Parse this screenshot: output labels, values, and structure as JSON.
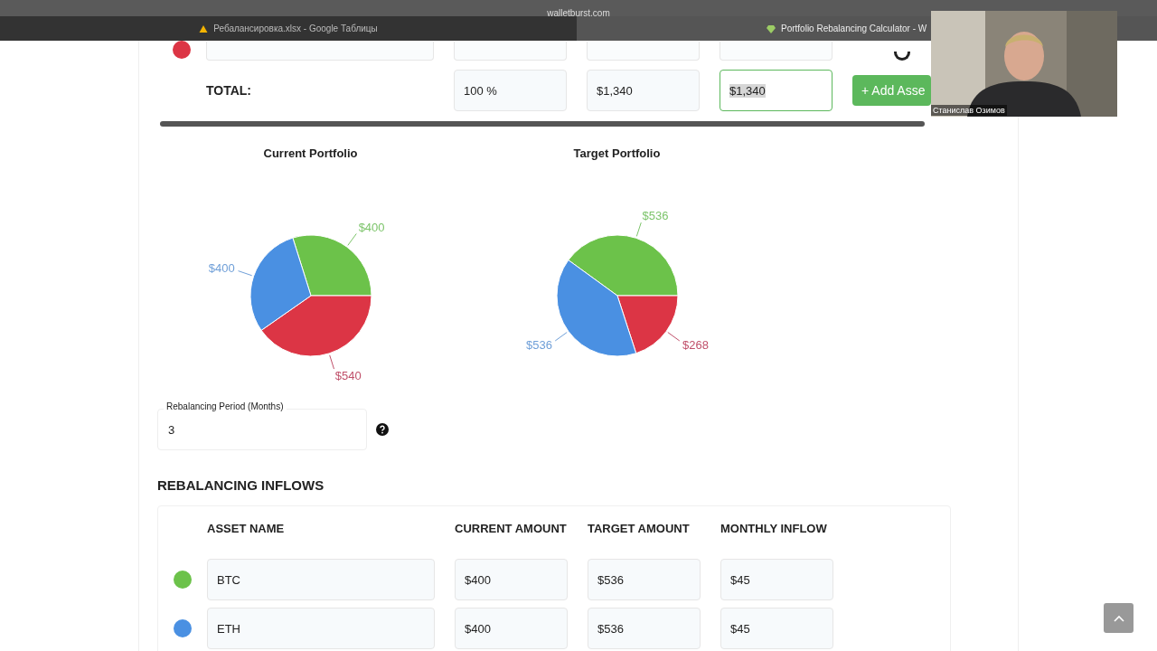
{
  "browser": {
    "address": "walletburst.com",
    "tabs": [
      {
        "title": "Ребалансировка.xlsx - Google Таблицы",
        "selected": false
      },
      {
        "title": "Portfolio Rebalancing Calculator - W",
        "selected": true
      }
    ]
  },
  "webcam": {
    "kind": "picture",
    "name": "Станислав Озимов"
  },
  "allocation": {
    "partial_row": {
      "color": "#dc3545"
    },
    "total": {
      "label": "TOTAL:",
      "percent": "100 %",
      "current": "$1,340",
      "target": "$1,340"
    },
    "add_button": "+ Add Asse"
  },
  "charts": [
    {
      "title": "Current Portfolio",
      "chart_data": {
        "type": "pie",
        "values": [
          400,
          540,
          400
        ],
        "value_labels": [
          "$400",
          "$540",
          "$400"
        ]
      }
    },
    {
      "title": "Target Portfolio",
      "chart_data": {
        "type": "pie",
        "values": [
          536,
          268,
          536
        ],
        "value_labels": [
          "$536",
          "$268",
          "$536"
        ]
      }
    }
  ],
  "period": {
    "label": "Rebalancing Period (Months)",
    "value": "3"
  },
  "inflows": {
    "heading": "REBALANCING INFLOWS",
    "columns": [
      "ASSET NAME",
      "CURRENT AMOUNT",
      "TARGET AMOUNT",
      "MONTHLY INFLOW"
    ],
    "rows": [
      {
        "color": "#6cc24a",
        "name": "BTC",
        "current": "$400",
        "target": "$536",
        "inflow": "$45"
      },
      {
        "color": "#4a90e2",
        "name": "ETH",
        "current": "$400",
        "target": "$536",
        "inflow": "$45"
      }
    ]
  }
}
